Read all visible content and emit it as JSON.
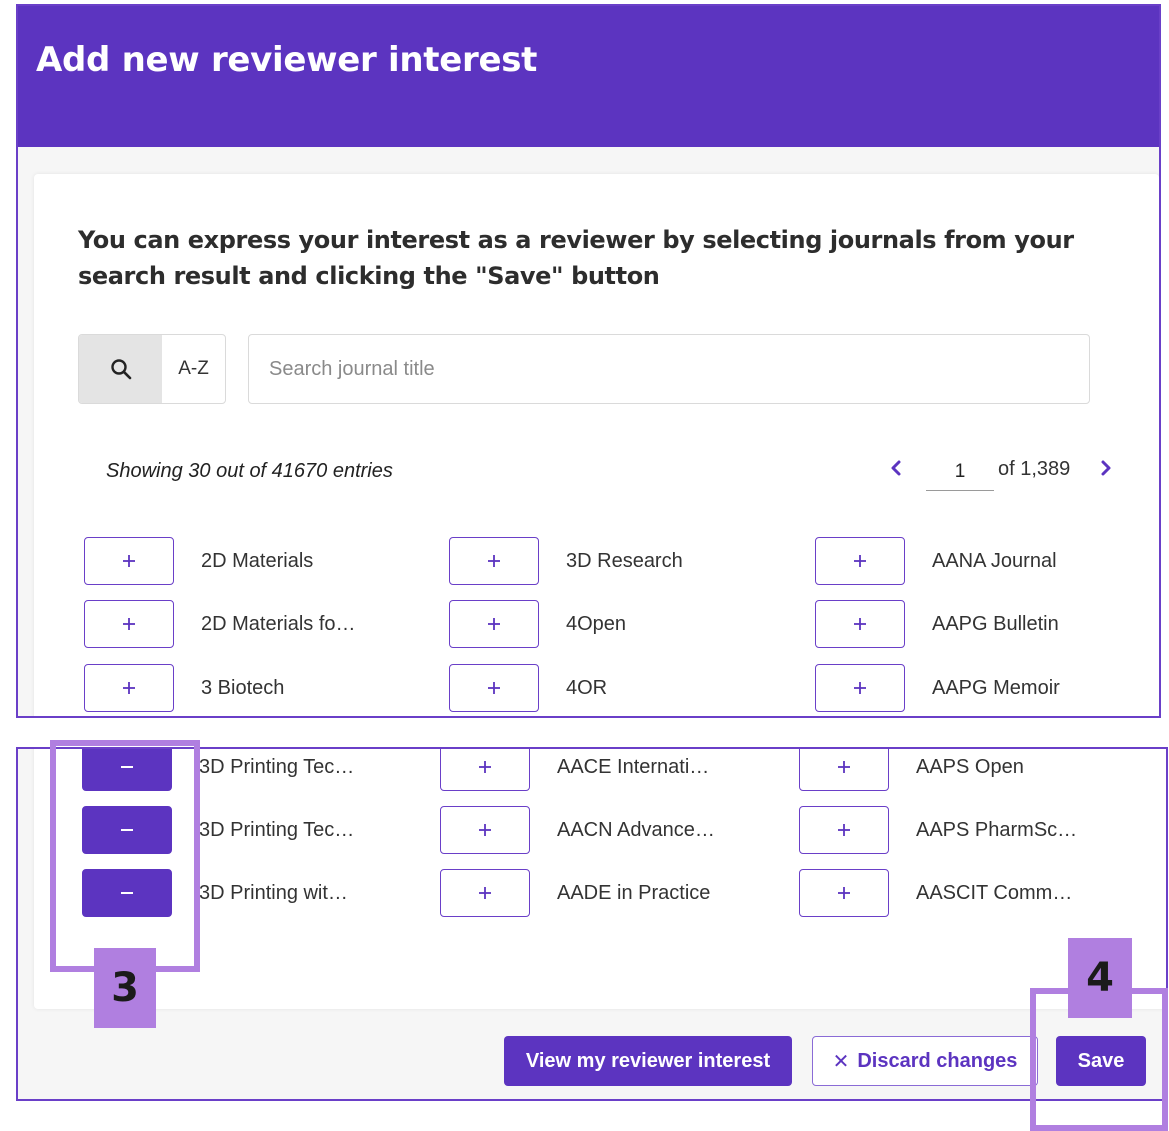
{
  "header": {
    "title": "Add new reviewer interest"
  },
  "instruction": "You can express your interest as a reviewer by selecting journals from your search result and clicking the \"Save\" button",
  "search": {
    "az_label": "A-Z",
    "placeholder": "Search journal title"
  },
  "results": {
    "showing_text": "Showing 30 out of 41670 entries"
  },
  "pagination": {
    "current_page": "1",
    "of_text": "of 1,389"
  },
  "journals_top": [
    {
      "name": "2D Materials",
      "selected": false
    },
    {
      "name": "3D Research",
      "selected": false
    },
    {
      "name": "AANA Journal",
      "selected": false
    },
    {
      "name": "2D Materials fo…",
      "selected": false
    },
    {
      "name": "4Open",
      "selected": false
    },
    {
      "name": "AAPG Bulletin",
      "selected": false
    },
    {
      "name": "3 Biotech",
      "selected": false
    },
    {
      "name": "4OR",
      "selected": false
    },
    {
      "name": "AAPG Memoir",
      "selected": false
    }
  ],
  "journals_bottom": [
    {
      "name": "3D Printing Tec…",
      "selected": true
    },
    {
      "name": "AACE Internati…",
      "selected": false
    },
    {
      "name": "AAPS Open",
      "selected": false
    },
    {
      "name": "3D Printing Tec…",
      "selected": true
    },
    {
      "name": "AACN Advance…",
      "selected": false
    },
    {
      "name": "AAPS PharmSc…",
      "selected": false
    },
    {
      "name": "3D Printing wit…",
      "selected": true
    },
    {
      "name": "AADE in Practice",
      "selected": false
    },
    {
      "name": "AASCIT Comm…",
      "selected": false
    }
  ],
  "actions": {
    "view_label": "View my reviewer interest",
    "discard_label": "Discard changes",
    "save_label": "Save"
  },
  "annotations": {
    "step_3": "3",
    "step_4": "4"
  },
  "colors": {
    "brand": "#5c34c0",
    "annotation": "#b07fe0",
    "border": "#6a3fc8"
  }
}
